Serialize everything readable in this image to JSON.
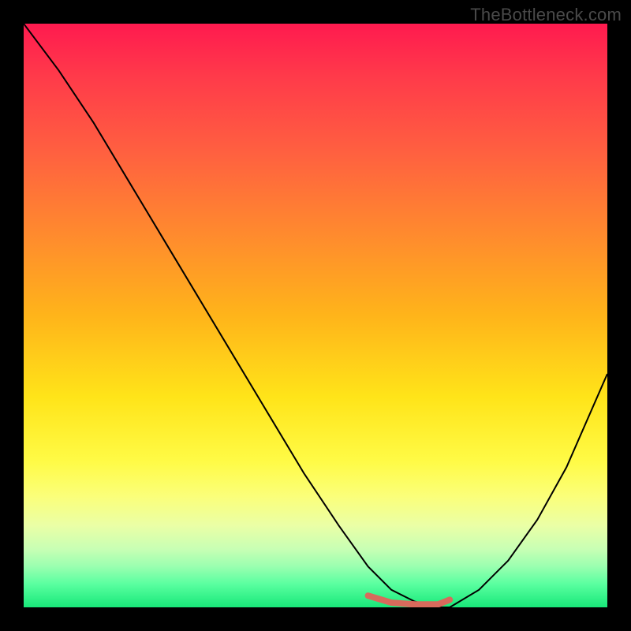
{
  "watermark": "TheBottleneck.com",
  "chart_data": {
    "type": "line",
    "title": "",
    "xlabel": "",
    "ylabel": "",
    "xlim": [
      0,
      100
    ],
    "ylim": [
      0,
      100
    ],
    "grid": false,
    "background_gradient": {
      "direction": "vertical",
      "stops": [
        {
          "pct": 0,
          "color": "#ff1a4f"
        },
        {
          "pct": 9,
          "color": "#ff3a4a"
        },
        {
          "pct": 22,
          "color": "#ff6040"
        },
        {
          "pct": 36,
          "color": "#ff8a2e"
        },
        {
          "pct": 50,
          "color": "#ffb41a"
        },
        {
          "pct": 64,
          "color": "#ffe419"
        },
        {
          "pct": 75,
          "color": "#fffb46"
        },
        {
          "pct": 81,
          "color": "#fbff7a"
        },
        {
          "pct": 86,
          "color": "#eaffa6"
        },
        {
          "pct": 90,
          "color": "#c8ffb4"
        },
        {
          "pct": 93,
          "color": "#9affb0"
        },
        {
          "pct": 96,
          "color": "#5affa0"
        },
        {
          "pct": 100,
          "color": "#18e879"
        }
      ]
    },
    "series": [
      {
        "name": "bottleneck-curve",
        "color": "#000000",
        "stroke_width": 2,
        "x": [
          0,
          6,
          12,
          18,
          24,
          30,
          36,
          42,
          48,
          54,
          59,
          63,
          67,
          71,
          73,
          78,
          83,
          88,
          93,
          100
        ],
        "y": [
          100,
          92,
          83,
          73,
          63,
          53,
          43,
          33,
          23,
          14,
          7,
          3,
          1,
          0,
          0,
          3,
          8,
          15,
          24,
          40
        ]
      }
    ],
    "optimal_marker": {
      "name": "optimal-range",
      "color": "#d86a5c",
      "stroke_width": 8,
      "linecap": "round",
      "x": [
        59,
        63,
        67,
        71,
        73
      ],
      "y": [
        2.0,
        0.8,
        0.5,
        0.5,
        1.3
      ]
    }
  }
}
